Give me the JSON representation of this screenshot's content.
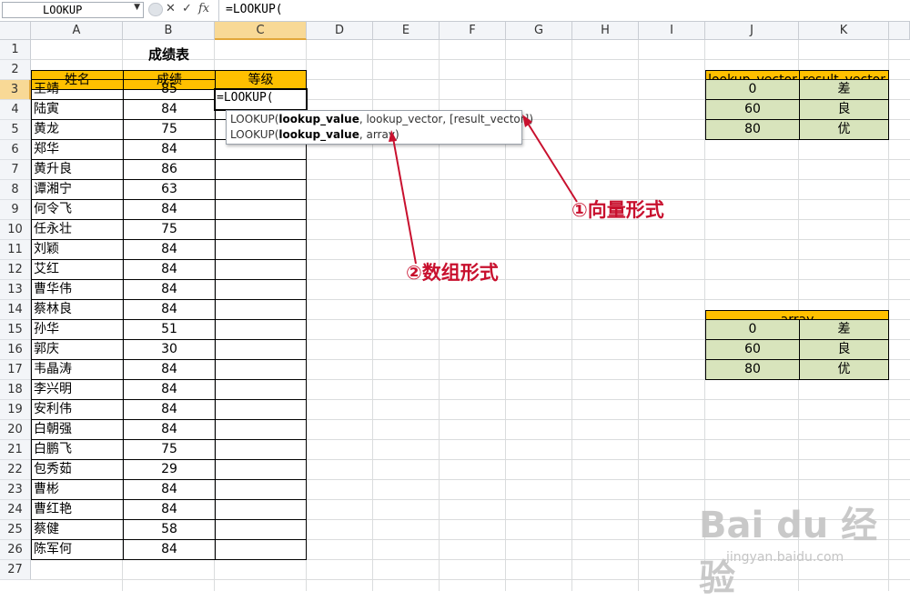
{
  "formula_bar": {
    "name_box": "LOOKUP",
    "cancel_icon": "✕",
    "enter_icon": "✓",
    "fx_label": "fx",
    "formula": "=LOOKUP("
  },
  "columns": [
    "A",
    "B",
    "C",
    "D",
    "E",
    "F",
    "G",
    "H",
    "I",
    "J",
    "K"
  ],
  "rows": [
    "1",
    "2",
    "3",
    "4",
    "5",
    "6",
    "7",
    "8",
    "9",
    "10",
    "11",
    "12",
    "13",
    "14",
    "15",
    "16",
    "17",
    "18",
    "19",
    "20",
    "21",
    "22",
    "23",
    "24",
    "25",
    "26",
    "27"
  ],
  "sheet": {
    "title": "成绩表",
    "headers": {
      "name": "姓名",
      "score": "成绩",
      "grade": "等级"
    },
    "active_cell_text": "=LOOKUP(",
    "records": [
      {
        "name": "王靖",
        "score": "85"
      },
      {
        "name": "陆寅",
        "score": "84"
      },
      {
        "name": "黄龙",
        "score": "75"
      },
      {
        "name": "郑华",
        "score": "84"
      },
      {
        "name": "黄升良",
        "score": "86"
      },
      {
        "name": "谭湘宁",
        "score": "63"
      },
      {
        "name": "何令飞",
        "score": "84"
      },
      {
        "name": "任永壮",
        "score": "75"
      },
      {
        "name": "刘颖",
        "score": "84"
      },
      {
        "name": "艾红",
        "score": "84"
      },
      {
        "name": "曹华伟",
        "score": "84"
      },
      {
        "name": "蔡林良",
        "score": "84"
      },
      {
        "name": "孙华",
        "score": "51"
      },
      {
        "name": "郭庆",
        "score": "30"
      },
      {
        "name": "韦晶涛",
        "score": "84"
      },
      {
        "name": "李兴明",
        "score": "84"
      },
      {
        "name": "安利伟",
        "score": "84"
      },
      {
        "name": "白朝强",
        "score": "84"
      },
      {
        "name": "白鹏飞",
        "score": "75"
      },
      {
        "name": "包秀茹",
        "score": "29"
      },
      {
        "name": "曹彬",
        "score": "84"
      },
      {
        "name": "曹红艳",
        "score": "84"
      },
      {
        "name": "蔡健",
        "score": "58"
      },
      {
        "name": "陈军何",
        "score": "84"
      }
    ]
  },
  "vector_table": {
    "header_lookup": "lookup_vector",
    "header_result": "result_vector",
    "rows": [
      {
        "lookup": "0",
        "result": "差"
      },
      {
        "lookup": "60",
        "result": "良"
      },
      {
        "lookup": "80",
        "result": "优"
      }
    ]
  },
  "array_table": {
    "header": "array",
    "rows": [
      {
        "lookup": "0",
        "result": "差"
      },
      {
        "lookup": "60",
        "result": "良"
      },
      {
        "lookup": "80",
        "result": "优"
      }
    ]
  },
  "tooltip": {
    "line1_fn": "LOOKUP(",
    "line1_bold": "lookup_value",
    "line1_rest": ", lookup_vector, [result_vector])",
    "line2_fn": "LOOKUP(",
    "line2_bold": "lookup_value",
    "line2_rest": ", array)"
  },
  "annotations": {
    "vector_form": "①向量形式",
    "array_form": "②数组形式"
  },
  "watermark": {
    "brand": "Bai du 经验",
    "url": "jingyan.baidu.com"
  },
  "colors": {
    "accent_red": "#c8102e",
    "header_orange": "#ffc000",
    "table_green": "#d8e4bc",
    "selected_header": "#f8d996"
  }
}
